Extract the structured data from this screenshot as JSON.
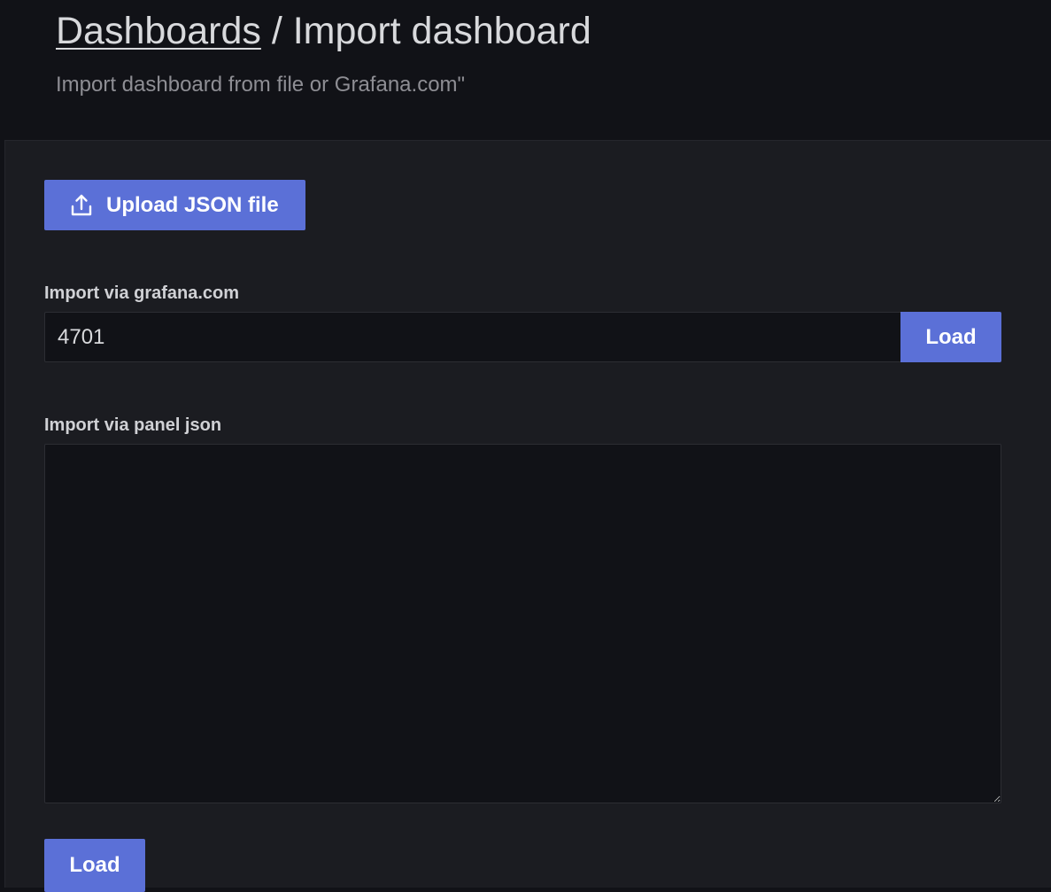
{
  "header": {
    "breadcrumb_link": "Dashboards",
    "breadcrumb_separator": " / ",
    "breadcrumb_current": "Import dashboard",
    "subtitle": "Import dashboard from file or Grafana.com\""
  },
  "upload": {
    "icon": "upload-icon",
    "label": "Upload JSON file"
  },
  "grafana_import": {
    "label": "Import via grafana.com",
    "value": "4701",
    "load_label": "Load"
  },
  "panel_json": {
    "label": "Import via panel json",
    "value": ""
  },
  "footer": {
    "load_label": "Load"
  },
  "colors": {
    "primary_button": "#5b70d7",
    "page_background": "#111217",
    "content_background": "#1b1c21"
  }
}
